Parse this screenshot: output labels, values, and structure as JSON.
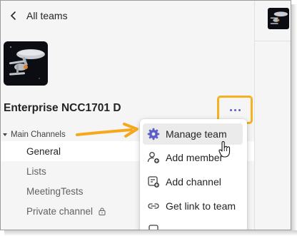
{
  "nav": {
    "back_label": "All teams"
  },
  "team": {
    "name": "Enterprise NCC1701 D"
  },
  "sidebar": {
    "section_label": "Main Channels",
    "channels": [
      {
        "label": "General",
        "selected": true
      },
      {
        "label": "Lists"
      },
      {
        "label": "MeetingTests"
      },
      {
        "label": "Private channel",
        "private": true
      }
    ]
  },
  "menu": {
    "items": [
      {
        "label": "Manage team",
        "icon": "gear-icon",
        "hovered": true
      },
      {
        "label": "Add member",
        "icon": "add-person-icon"
      },
      {
        "label": "Add channel",
        "icon": "add-channel-icon"
      },
      {
        "label": "Get link to team",
        "icon": "link-icon"
      }
    ]
  },
  "colors": {
    "accent": "#5b5fc7",
    "highlight": "#f5b11e",
    "background": "#f5f5f5"
  }
}
